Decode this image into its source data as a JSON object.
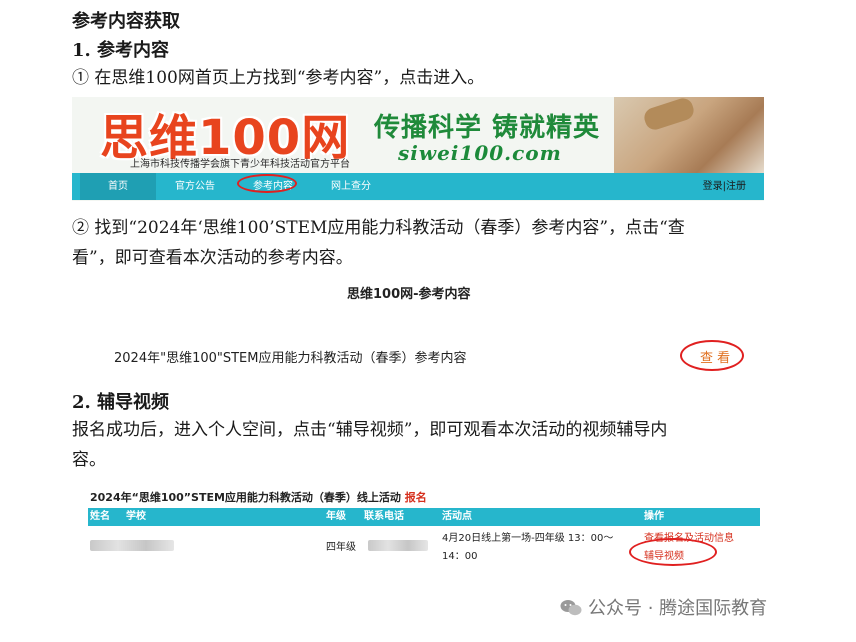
{
  "heading": "参考内容获取",
  "section1": {
    "title": "1.  参考内容",
    "step1": "① 在思维100网首页上方找到“参考内容”，点击进入。",
    "step2_line1": "② 找到“2024年‘思维100’STEM应用能力科教活动（春季）参考内容”，点击“查",
    "step2_line2": "看”，即可查看本次活动的参考内容。"
  },
  "banner": {
    "brand": "思维100网",
    "subtitle": "上海市科技传播学会旗下青少年科技活动官方平台",
    "slogan": "传播科学  铸就精英",
    "url": "siwei100.com",
    "nav": [
      "首页",
      "官方公告",
      "参考内容",
      "网上查分"
    ],
    "login": "登录",
    "separator": "|",
    "register": "注册"
  },
  "reference_page": {
    "title": "思维100网-参考内容",
    "item": "2024年\"思维100\"STEM应用能力科教活动（春季）参考内容",
    "view": "查 看"
  },
  "section2": {
    "title": "2.  辅导视频",
    "para_line1": "报名成功后，进入个人空间，点击“辅导视频”，即可观看本次活动的视频辅导内",
    "para_line2": "容。"
  },
  "activity": {
    "title": "2024年“思维100”STEM应用能力科教活动（春季）线上活动",
    "register_tag": "报名",
    "columns": [
      "姓名",
      "学校",
      "年级",
      "联系电话",
      "活动点",
      "操作"
    ],
    "row": {
      "grade": "四年级",
      "venue_line1": "4月20日线上第一场-四年级 13：00～",
      "venue_line2": "14：00",
      "action1": "查看报名及活动信息",
      "action2": "辅导视频"
    }
  },
  "watermark": "公众号 · 腾途国际教育",
  "colors": {
    "nav": "#26b6cc",
    "highlight_ring": "#e02020",
    "brand": "#e8441e",
    "slogan": "#1f8a3a"
  }
}
